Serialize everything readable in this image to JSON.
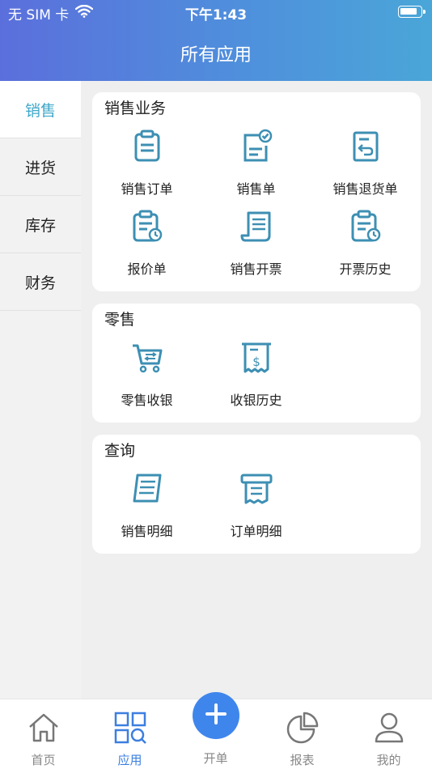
{
  "status_bar": {
    "carrier": "无 SIM 卡",
    "time": "下午1:43",
    "icons": [
      "wifi-icon",
      "battery-icon"
    ]
  },
  "header": {
    "title": "所有应用"
  },
  "sidebar": {
    "items": [
      {
        "label": "销售",
        "active": true
      },
      {
        "label": "进货",
        "active": false
      },
      {
        "label": "库存",
        "active": false
      },
      {
        "label": "财务",
        "active": false
      }
    ]
  },
  "sections": [
    {
      "title": "销售业务",
      "items": [
        {
          "label": "销售订单",
          "icon": "clipboard-icon"
        },
        {
          "label": "销售单",
          "icon": "document-check-icon"
        },
        {
          "label": "销售退货单",
          "icon": "return-document-icon"
        },
        {
          "label": "报价单",
          "icon": "clipboard-clock-icon"
        },
        {
          "label": "销售开票",
          "icon": "invoice-scroll-icon"
        },
        {
          "label": "开票历史",
          "icon": "clipboard-history-icon"
        }
      ]
    },
    {
      "title": "零售",
      "items": [
        {
          "label": "零售收银",
          "icon": "cart-icon"
        },
        {
          "label": "收银历史",
          "icon": "dollar-receipt-icon"
        }
      ]
    },
    {
      "title": "查询",
      "items": [
        {
          "label": "销售明细",
          "icon": "list-document-icon"
        },
        {
          "label": "订单明细",
          "icon": "receipt-icon"
        }
      ]
    }
  ],
  "tabbar": {
    "items": [
      {
        "label": "首页",
        "icon": "home-icon",
        "active": false
      },
      {
        "label": "应用",
        "icon": "apps-search-icon",
        "active": true
      },
      {
        "label": "开单",
        "icon": "plus-icon",
        "active": false
      },
      {
        "label": "报表",
        "icon": "pie-chart-icon",
        "active": false
      },
      {
        "label": "我的",
        "icon": "user-icon",
        "active": false
      }
    ]
  },
  "colors": {
    "accent": "#3fa8c9",
    "icon": "#3d8fb3",
    "tab_active": "#3c7fe0",
    "fab": "#3f86ec"
  }
}
